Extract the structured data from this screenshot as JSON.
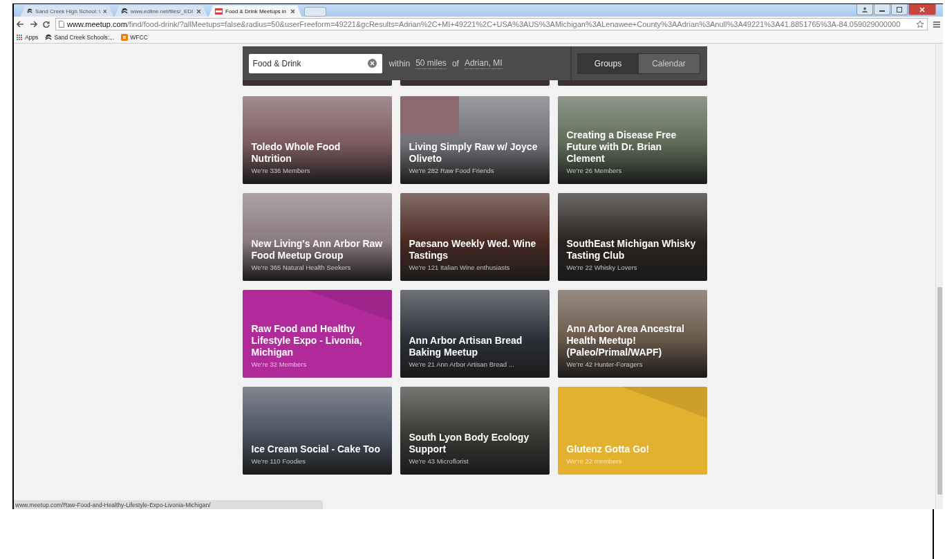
{
  "browser": {
    "tabs": [
      {
        "title": "Sand Creek High School: \\",
        "selected": false
      },
      {
        "title": "www.edline.net/files/_EDI",
        "selected": false
      },
      {
        "title": "Food & Drink Meetups in",
        "selected": true
      }
    ],
    "address": {
      "host": "www.meetup.com",
      "path": "/find/food-drink/?allMeetups=false&radius=50&userFreeform=49221&gcResults=Adrian%2C+MI+49221%2C+USA%3AUS%3AMichigan%3ALenawee+County%3AAdrian%3Anull%3A49221%3A41.8851765%3A-84.059029000000"
    },
    "bookmarks": [
      {
        "label": "Apps"
      },
      {
        "label": "Sand Creek Schools:..."
      },
      {
        "label": "WFCC"
      }
    ],
    "status_url": "www.meetup.com/Raw-Food-and-Healthy-Lifestyle-Expo-Livonia-Michigan/"
  },
  "search": {
    "value": "Food & Drink",
    "within": "within",
    "distance": "50 miles",
    "of": "of",
    "location": "Adrian, MI",
    "views": [
      {
        "label": "Groups",
        "selected": true
      },
      {
        "label": "Calendar",
        "selected": false
      }
    ]
  },
  "groups": [
    {
      "name": "Toledo Whole Food Nutrition",
      "members": "We're 336 Members",
      "kind": "photo",
      "color": "#7a5a5e"
    },
    {
      "name": "Living Simply Raw w/ Joyce Oliveto",
      "members": "We're 282 Raw Food Friends",
      "kind": "inset",
      "color": "#6f6f75"
    },
    {
      "name": "Creating a Disease Free Future with Dr. Brian Clement",
      "members": "We're 26 Members",
      "kind": "photo",
      "color": "#5d6a55"
    },
    {
      "name": "New Living's Ann Arbor Raw Food Meetup Group",
      "members": "We're 365 Natural Health Seekers",
      "kind": "photo",
      "color": "#8a7a82"
    },
    {
      "name": "Paesano Weekly Wed. Wine Tastings",
      "members": "We're 121 Italian Wine enthusiasts",
      "kind": "photo",
      "color": "#4a2a22"
    },
    {
      "name": "SouthEast Michigan Whisky Tasting Club",
      "members": "We're 22 Whisky Lovers",
      "kind": "photo",
      "color": "#2a2420"
    },
    {
      "name": "Raw Food and Healthy Lifestyle Expo - Livonia, Michigan",
      "members": "We're 32 Members",
      "kind": "pattern",
      "color": "#b02a9a"
    },
    {
      "name": "Ann Arbor Artisan Bread Baking Meetup",
      "members": "We're 21 Ann Arbor Artisan Bread ...",
      "kind": "photo",
      "color": "#2c3038"
    },
    {
      "name": "Ann Arbor Area Ancestral Health Meetup! (Paleo/Primal/WAPF)",
      "members": "We're 42 Hunter-Foragers",
      "kind": "photo",
      "color": "#6a5a4a"
    },
    {
      "name": "Ice Cream Social - Cake Too",
      "members": "We're 110 Foodies",
      "kind": "photo",
      "color": "#4a5060"
    },
    {
      "name": "South Lyon Body Ecology Support",
      "members": "We're 43 Microflorist",
      "kind": "photo",
      "color": "#3a3834"
    },
    {
      "name": "Glutenz Gotta Go!",
      "members": "We're 22 members",
      "kind": "pattern",
      "color": "#e2b12e"
    }
  ]
}
